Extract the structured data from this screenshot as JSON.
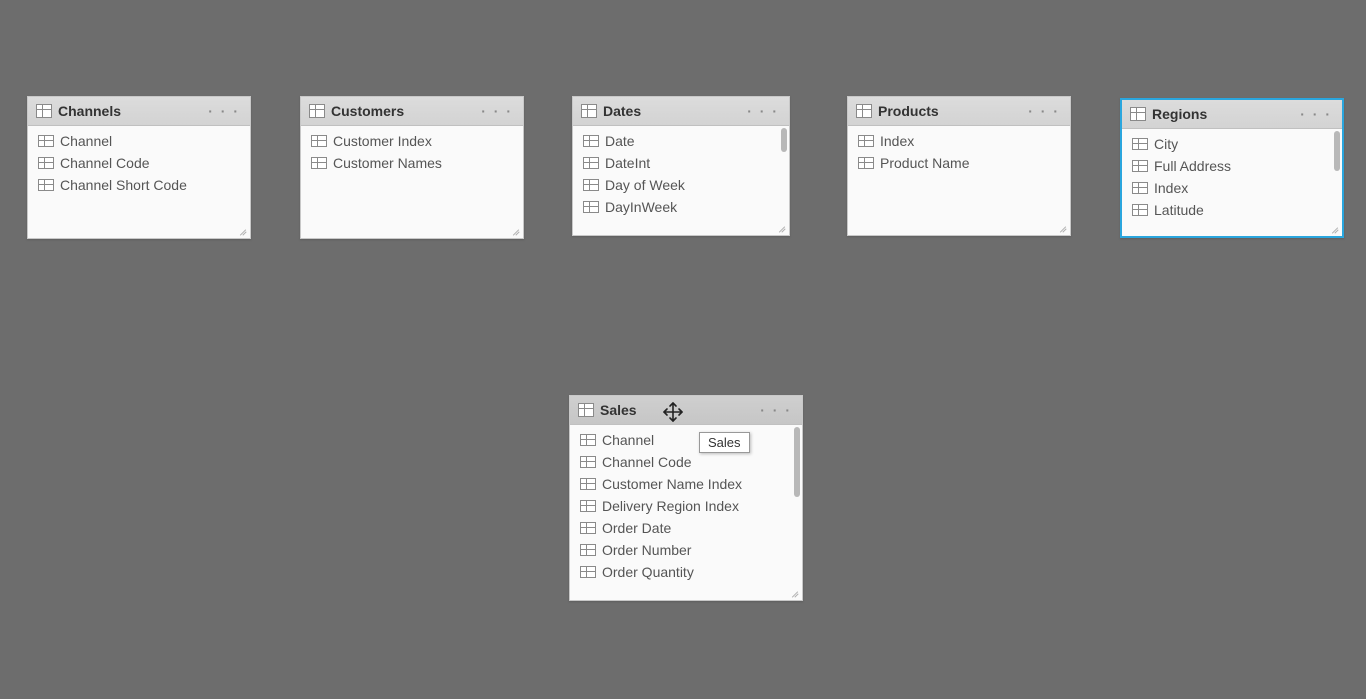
{
  "tables": {
    "channels": {
      "title": "Channels",
      "fields": [
        "Channel",
        "Channel Code",
        "Channel Short Code"
      ]
    },
    "customers": {
      "title": "Customers",
      "fields": [
        "Customer Index",
        "Customer Names"
      ]
    },
    "dates": {
      "title": "Dates",
      "fields": [
        "Date",
        "DateInt",
        "Day of Week",
        "DayInWeek"
      ]
    },
    "products": {
      "title": "Products",
      "fields": [
        "Index",
        "Product Name"
      ]
    },
    "regions": {
      "title": "Regions",
      "fields": [
        "City",
        "Full Address",
        "Index",
        "Latitude"
      ]
    },
    "sales": {
      "title": "Sales",
      "fields": [
        "Channel",
        "Channel Code",
        "Customer Name Index",
        "Delivery Region Index",
        "Order Date",
        "Order Number",
        "Order Quantity"
      ]
    }
  },
  "tooltip": {
    "text": "Sales"
  },
  "more_label": "· · ·"
}
